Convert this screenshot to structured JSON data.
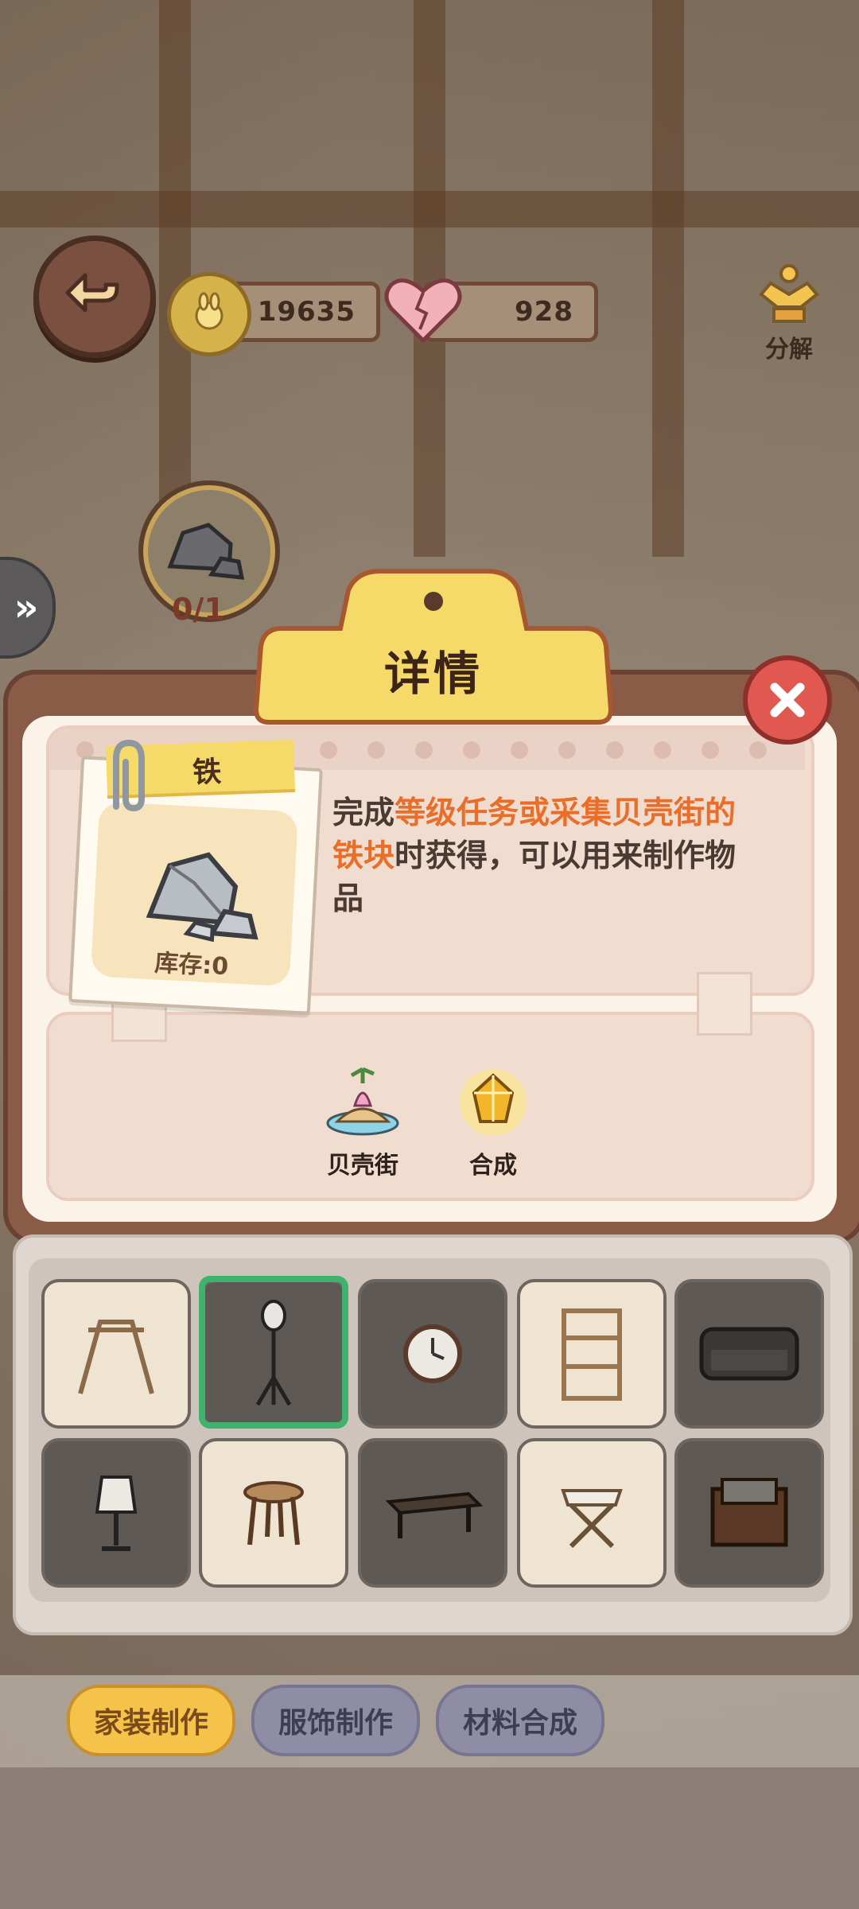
{
  "hud": {
    "coins": "19635",
    "hearts": "928",
    "decompose_label": "分解"
  },
  "material_slot": {
    "count": "0/1"
  },
  "dialog": {
    "title": "详情",
    "item_name": "铁",
    "stock": "库存:0",
    "description_prefix": "完成",
    "description_highlight": "等级任务或采集贝壳街的铁块",
    "description_suffix": "时获得，可以用来制作物品",
    "sources": [
      {
        "label": "贝壳街",
        "icon": "island-icon"
      },
      {
        "label": "合成",
        "icon": "crystal-icon"
      }
    ]
  },
  "grid_items": [
    {
      "name": "clothes-rack",
      "state": "light"
    },
    {
      "name": "floor-lamp",
      "state": "dark",
      "selected": true
    },
    {
      "name": "wall-clock",
      "state": "dark"
    },
    {
      "name": "bookshelf",
      "state": "light"
    },
    {
      "name": "sofa",
      "state": "dark"
    },
    {
      "name": "table-lamp",
      "state": "dark"
    },
    {
      "name": "stool",
      "state": "light"
    },
    {
      "name": "coffee-table",
      "state": "dark"
    },
    {
      "name": "folding-stool",
      "state": "light"
    },
    {
      "name": "cabinet",
      "state": "dark"
    }
  ],
  "tabs": [
    {
      "label": "家装制作",
      "active": true
    },
    {
      "label": "服饰制作",
      "active": false
    },
    {
      "label": "材料合成",
      "active": false
    }
  ],
  "colors": {
    "accent": "#e86e2a",
    "selection": "#3fb36d",
    "banner": "#f5da6a"
  }
}
